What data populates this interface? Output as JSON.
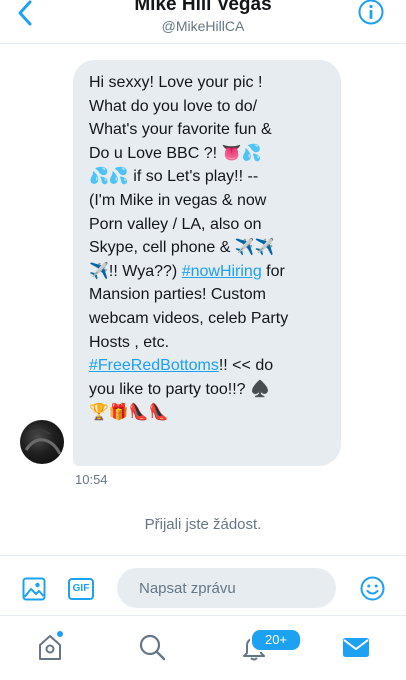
{
  "header": {
    "title": "Mike Hill Vegas",
    "handle": "@MikeHillCA"
  },
  "conversation": {
    "message": {
      "part1": "Hi sexxy! Love your pic !\nWhat do you love to do/\nWhat's your favorite fun &\nDo u Love BBC ?! 👅💦\n💦💦 if so Let's play!!  --\n(I'm Mike in vegas & now\nPorn valley / LA, also on\nSkype, cell phone & ✈️✈️\n✈️!! Wya??) ",
      "hashtag1": "#nowHiring",
      "part2": " for\nMansion parties! Custom\nwebcam videos, celeb Party\nHosts , etc.\n",
      "hashtag2": "#FreeRedBottoms",
      "part3": "!! << do\nyou like to party too!!? ♠️\n🏆🎁👠👠"
    },
    "timestamp": "10:54",
    "system_note": "Přijali jste žádost."
  },
  "composer": {
    "gif_label": "GIF",
    "placeholder": "Napsat zprávu",
    "value": ""
  },
  "tabbar": {
    "notification_badge": "20+"
  },
  "colors": {
    "accent": "#1da1f2",
    "bubble_bg": "#e6ecf0",
    "secondary_text": "#657786"
  },
  "icons": {
    "back": "chevron-left-icon",
    "info": "info-icon",
    "image": "image-icon",
    "emoji": "emoji-icon",
    "home": "home-icon",
    "search": "search-icon",
    "notifications": "bell-icon",
    "messages": "envelope-icon"
  }
}
